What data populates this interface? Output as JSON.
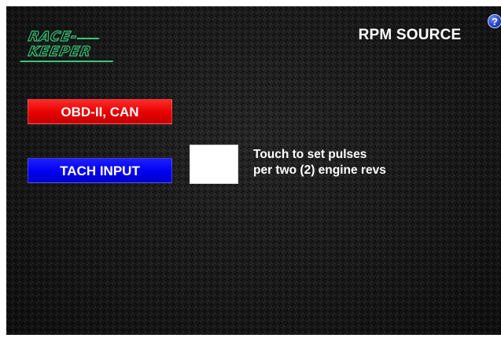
{
  "brand": {
    "logo_line1": "RACE-",
    "logo_line2": "KEEPER",
    "logo_color": "#37c77a"
  },
  "header": {
    "title": "RPM SOURCE",
    "help_glyph": "?",
    "help_icon": "help-question-icon"
  },
  "options": {
    "obd_label": "OBD-II, CAN",
    "obd_color": "#e60000",
    "tach_label": "TACH INPUT",
    "tach_color": "#0000f0"
  },
  "pulses": {
    "value": "",
    "hint_line1": "Touch to set pulses",
    "hint_line2": "per two (2) engine revs"
  }
}
